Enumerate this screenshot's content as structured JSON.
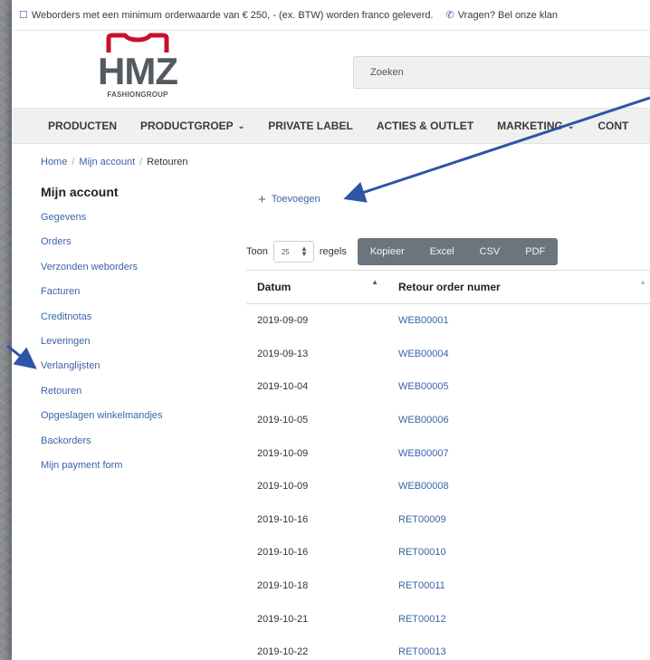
{
  "topbar": {
    "shipping_text": "Weborders met een minimum orderwaarde van € 250, - (ex. BTW) worden franco geleverd.",
    "contact_text": "Vragen? Bel onze klan"
  },
  "logo": {
    "main": "HMZ",
    "sub": "FASHIONGROUP",
    "color": "#c8102e"
  },
  "search": {
    "placeholder": "Zoeken"
  },
  "nav": {
    "items": [
      "PRODUCTEN",
      "PRODUCTGROEP",
      "PRIVATE LABEL",
      "ACTIES & OUTLET",
      "MARKETING",
      "CONT"
    ]
  },
  "breadcrumb": {
    "home": "Home",
    "account": "Mijn account",
    "current": "Retouren"
  },
  "sidebar": {
    "title": "Mijn account",
    "items": [
      "Gegevens",
      "Orders",
      "Verzonden weborders",
      "Facturen",
      "Creditnotas",
      "Leveringen",
      "Verlanglijsten",
      "Retouren",
      "Opgeslagen winkelmandjes",
      "Backorders",
      "Mijn payment form"
    ]
  },
  "actions": {
    "add_label": "Toevoegen"
  },
  "controls": {
    "show_label": "Toon",
    "page_size": "25",
    "rows_label": "regels",
    "export_buttons": [
      "Kopieer",
      "Excel",
      "CSV",
      "PDF"
    ]
  },
  "table": {
    "headers": [
      "Datum",
      "Retour order numer"
    ],
    "rows": [
      [
        "2019-09-09",
        "WEB00001"
      ],
      [
        "2019-09-13",
        "WEB00004"
      ],
      [
        "2019-10-04",
        "WEB00005"
      ],
      [
        "2019-10-05",
        "WEB00006"
      ],
      [
        "2019-10-09",
        "WEB00007"
      ],
      [
        "2019-10-09",
        "WEB00008"
      ],
      [
        "2019-10-16",
        "RET00009"
      ],
      [
        "2019-10-16",
        "RET00010"
      ],
      [
        "2019-10-18",
        "RET00011"
      ],
      [
        "2019-10-21",
        "RET00012"
      ],
      [
        "2019-10-22",
        "RET00013"
      ]
    ]
  },
  "colors": {
    "link": "#3a64a8",
    "annotation_arrow": "#2f54a8",
    "button_group": "#6c757d"
  }
}
